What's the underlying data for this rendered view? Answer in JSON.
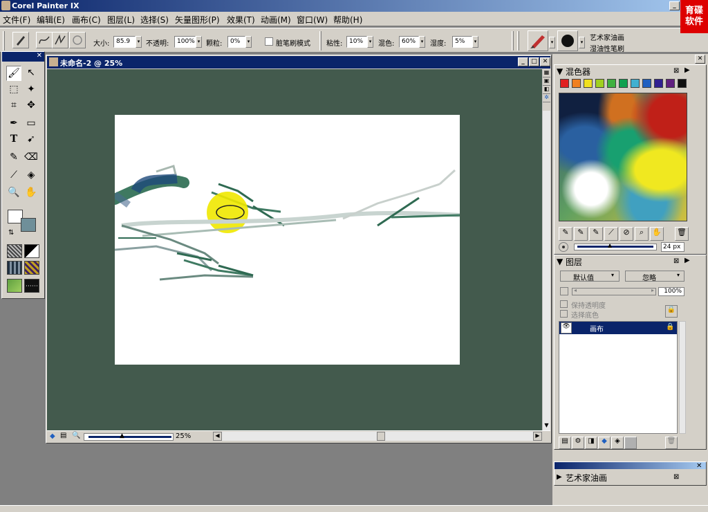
{
  "app": {
    "title": "Corel Painter IX",
    "watermark": "育碟软件"
  },
  "menu": [
    "文件(F)",
    "编辑(E)",
    "画布(C)",
    "图层(L)",
    "选择(S)",
    "矢量图形(P)",
    "效果(T)",
    "动画(M)",
    "窗口(W)",
    "帮助(H)"
  ],
  "toolbar": {
    "size_label": "大小:",
    "size_value": "85.9",
    "opacity_label": "不透明:",
    "opacity_value": "100%",
    "grain_label": "颗粒:",
    "grain_value": "0%",
    "dirty_mode_label": "脏笔刷模式",
    "viscosity_label": "粘性:",
    "viscosity_value": "10%",
    "blend_label": "混色:",
    "blend_value": "60%",
    "wetness_label": "湿度:",
    "wetness_value": "5%",
    "brush_category": "艺术家油画",
    "brush_variant": "湿油性笔刷"
  },
  "document": {
    "title": "未命名-2 @ 25%",
    "zoom": "25%",
    "canvas_color": "#ffffff",
    "background_color": "#435a4d"
  },
  "mixer": {
    "title": "混色器",
    "swatches": [
      "#e02020",
      "#f08020",
      "#f0e020",
      "#a0d020",
      "#40b040",
      "#10a050",
      "#40b0d0",
      "#2060c0",
      "#302090",
      "#602080",
      "#101010",
      "#a0a0a0",
      "#ffffff"
    ],
    "brush_size": "24 px"
  },
  "layers": {
    "title": "图层",
    "composite_method": "默认值",
    "composite_depth": "忽略",
    "opacity": "100%",
    "preserve_transparency": "保持透明度",
    "pick_up_underlying": "选择底色",
    "items": [
      {
        "name": "画布"
      }
    ]
  },
  "oil_panel": {
    "title": "艺术家油画"
  }
}
